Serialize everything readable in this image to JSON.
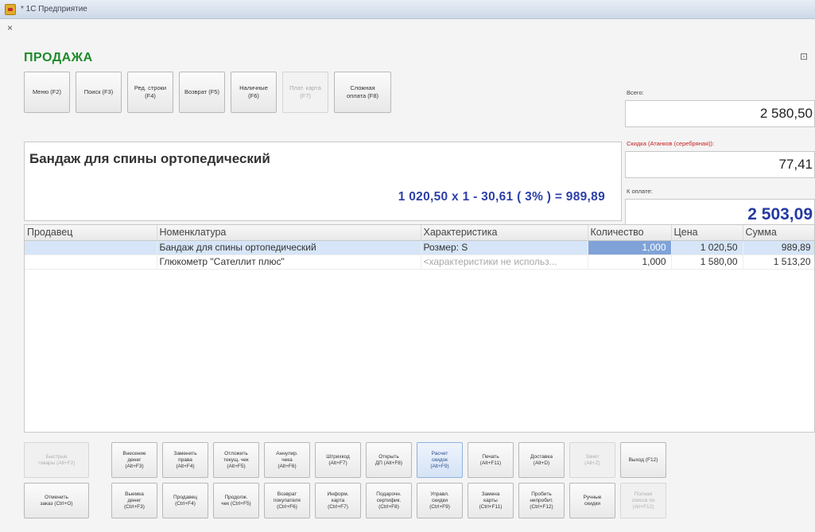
{
  "window": {
    "title": "* 1С Предприятие"
  },
  "form": {
    "close": "×",
    "title": "ПРОДАЖА",
    "corner_icon": "⊡"
  },
  "toolbar_top": [
    {
      "label": "Меню (F2)",
      "enabled": true
    },
    {
      "label": "Поиск (F3)",
      "enabled": true
    },
    {
      "label": "Ред. строки\n(F4)",
      "enabled": true
    },
    {
      "label": "Возврат (F5)",
      "enabled": true
    },
    {
      "label": "Наличные\n(F6)",
      "enabled": true
    },
    {
      "label": "Плат. карта\n(F7)",
      "enabled": false
    },
    {
      "label": "Сложная\nоплата (F8)",
      "enabled": true
    }
  ],
  "product": {
    "name": "Бандаж для спины ортопедический",
    "calc": "1 020,50  x 1  - 30,61  ( 3% )  = 989,89"
  },
  "totals": {
    "total_label": "Всего:",
    "total_value": "2 580,50",
    "discount_label": "Скидка (Атанков (серебряная)):",
    "discount_value": "77,41",
    "to_pay_label": "К оплате:",
    "to_pay_value": "2 503,09"
  },
  "table": {
    "columns": [
      "Продавец",
      "Номенклатура",
      "Характеристика",
      "Количество",
      "Цена",
      "Сумма"
    ],
    "rows": [
      {
        "seller": "",
        "item": "Бандаж для спины ортопедический",
        "characteristic": "Розмер: S",
        "qty": "1,000",
        "price": "1 020,50",
        "sum": "989,89"
      },
      {
        "seller": "",
        "item": "Глюкометр \"Сателлит плюс\"",
        "characteristic": "<характеристики не использ...",
        "qty": "1,000",
        "price": "1 580,00",
        "sum": "1 513,20"
      }
    ]
  },
  "bottom_row1": [
    {
      "label": "Быстрые\nтовары (Alt+F2)",
      "enabled": false
    },
    {
      "label": "Внесение\nденег\n(Alt+F3)",
      "enabled": true
    },
    {
      "label": "Заменить\nправа\n(Alt+F4)",
      "enabled": true
    },
    {
      "label": "Отложить\nтекущ. чек\n(Alt+F5)",
      "enabled": true
    },
    {
      "label": "Аннулир.\nчека\n(Alt+F6)",
      "enabled": true
    },
    {
      "label": "Штрихкод\n(Alt+F7)",
      "enabled": true
    },
    {
      "label": "Открыть\nДП (Alt+F8)",
      "enabled": true
    },
    {
      "label": "Расчет\nскидок\n(Alt+F9)",
      "enabled": true
    },
    {
      "label": "Печать\n(Alt+F11)",
      "enabled": true
    },
    {
      "label": "Доставка\n(Alt+D)",
      "enabled": true
    },
    {
      "label": "Зачет\n(Alt+Z)",
      "enabled": false
    },
    {
      "label": "Выход (F12)",
      "enabled": true
    }
  ],
  "bottom_row2": [
    {
      "label": "Отменить\nзаказ (Ctrl+O)",
      "enabled": true
    },
    {
      "label": "Выемка\nденег\n(Ctrl+F3)",
      "enabled": true
    },
    {
      "label": "Продавец\n(Ctrl+F4)",
      "enabled": true
    },
    {
      "label": "Продолж.\nчек (Ctrl+F5)",
      "enabled": true
    },
    {
      "label": "Возврат\nпокупателя\n(Ctrl+F6)",
      "enabled": true
    },
    {
      "label": "Информ.\nкарта\n(Ctrl+F7)",
      "enabled": true
    },
    {
      "label": "Подарочн.\nсертифик.\n(Ctrl+F8)",
      "enabled": true
    },
    {
      "label": "Управл.\nскидки\n(Ctrl+F9)",
      "enabled": true
    },
    {
      "label": "Замена\nкарты\n(Ctrl+F11)",
      "enabled": true
    },
    {
      "label": "Пробить\nнепробит.\n(Ctrl+F12)",
      "enabled": true
    },
    {
      "label": "Ручные\nскидки",
      "enabled": true
    },
    {
      "label": "Полная\nсписок по\n(Alt+F12)",
      "enabled": false
    }
  ]
}
